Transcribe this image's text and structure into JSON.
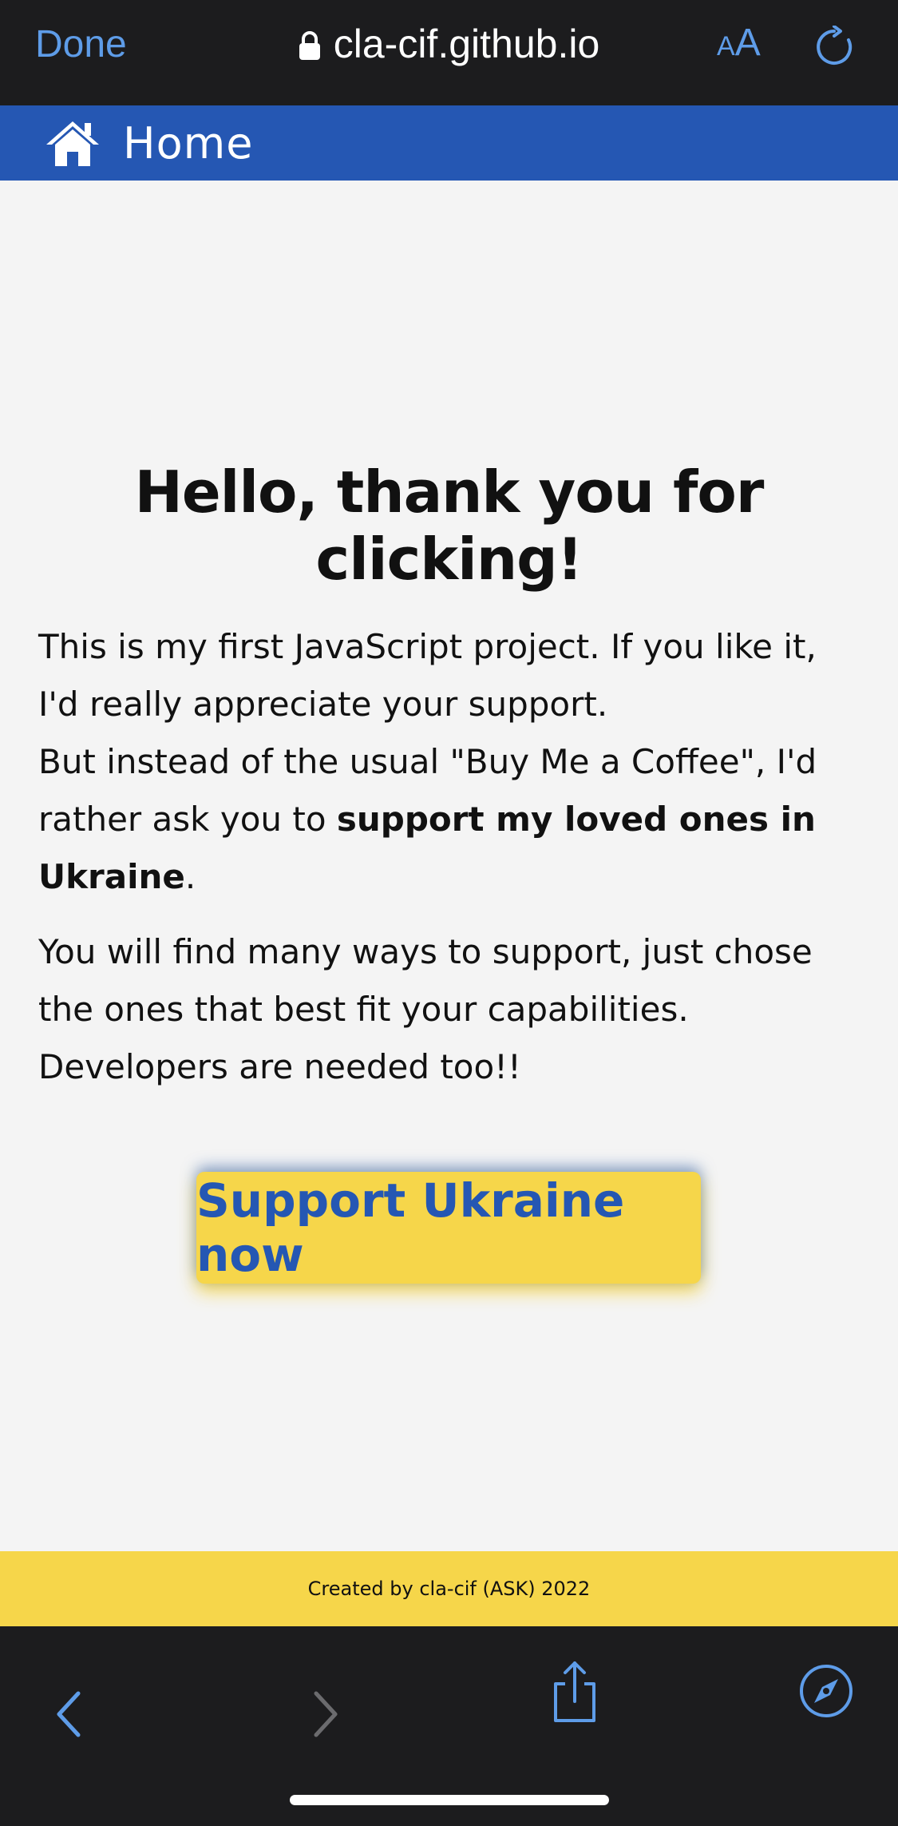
{
  "browser": {
    "done_label": "Done",
    "url": "cla-cif.github.io",
    "text_size_small": "A",
    "text_size_large": "A"
  },
  "nav": {
    "home_label": "Home"
  },
  "main": {
    "headline": "Hello, thank you for clicking!",
    "para1_line1": "This is my first JavaScript project. If you like it, I'd really appreciate your support.",
    "para1_line2_prefix": "But instead of the usual \"Buy Me a Coffee\", I'd rather ask you to ",
    "para1_line2_bold": "support my loved ones in Ukraine",
    "para1_line2_suffix": ".",
    "para2": "You will find many ways to support, just chose the ones that best fit your capabilities. Developers are needed too!!",
    "cta_label": "Support Ukraine now"
  },
  "footer": {
    "text": "Created by cla-cif (ASK) 2022"
  },
  "toolbar": {
    "back": "back-icon",
    "forward": "forward-icon",
    "share": "share-icon",
    "safari": "compass-icon"
  },
  "colors": {
    "nav_blue": "#2557b3",
    "ukraine_yellow": "#f6d64a",
    "ios_blue": "#5e9ce8"
  }
}
